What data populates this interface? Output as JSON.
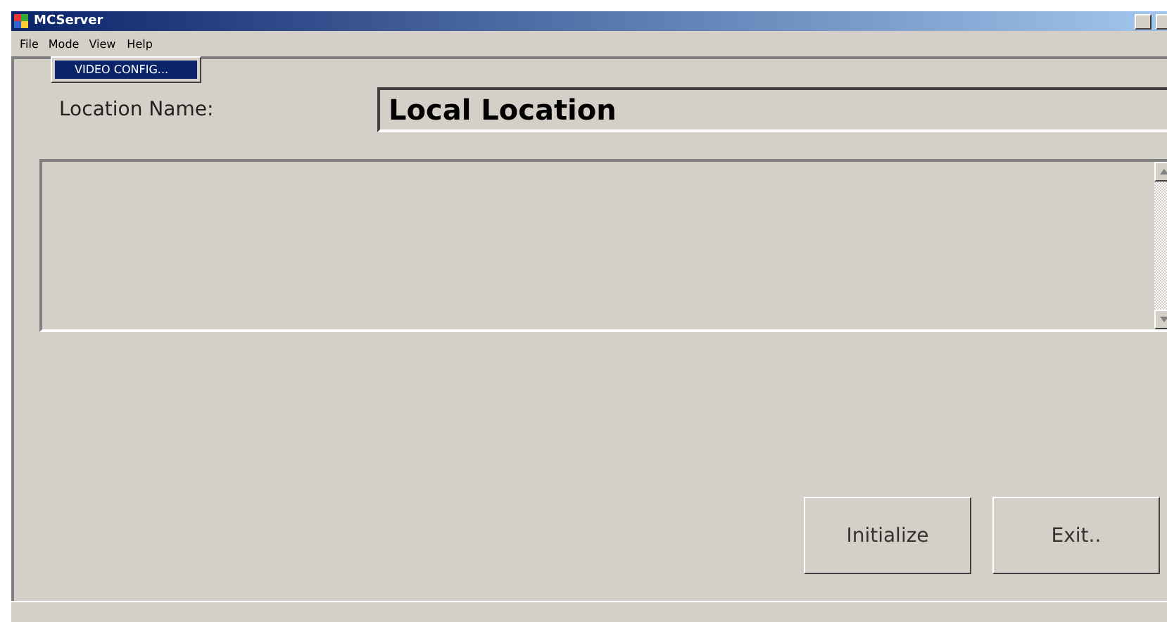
{
  "window": {
    "title": "MCServer"
  },
  "menu": [
    {
      "label": "File",
      "open": false
    },
    {
      "label": "Mode",
      "open": true
    },
    {
      "label": "View",
      "open": false
    },
    {
      "label": "Help",
      "open": false
    }
  ],
  "dropdown": {
    "items": [
      {
        "label": "VIDEO CONFIG...",
        "selected": true
      }
    ]
  },
  "location": {
    "label": "Location Name:",
    "value": "Local Location"
  },
  "buttons": [
    {
      "label": "Initialize"
    },
    {
      "label": "Exit.."
    }
  ]
}
